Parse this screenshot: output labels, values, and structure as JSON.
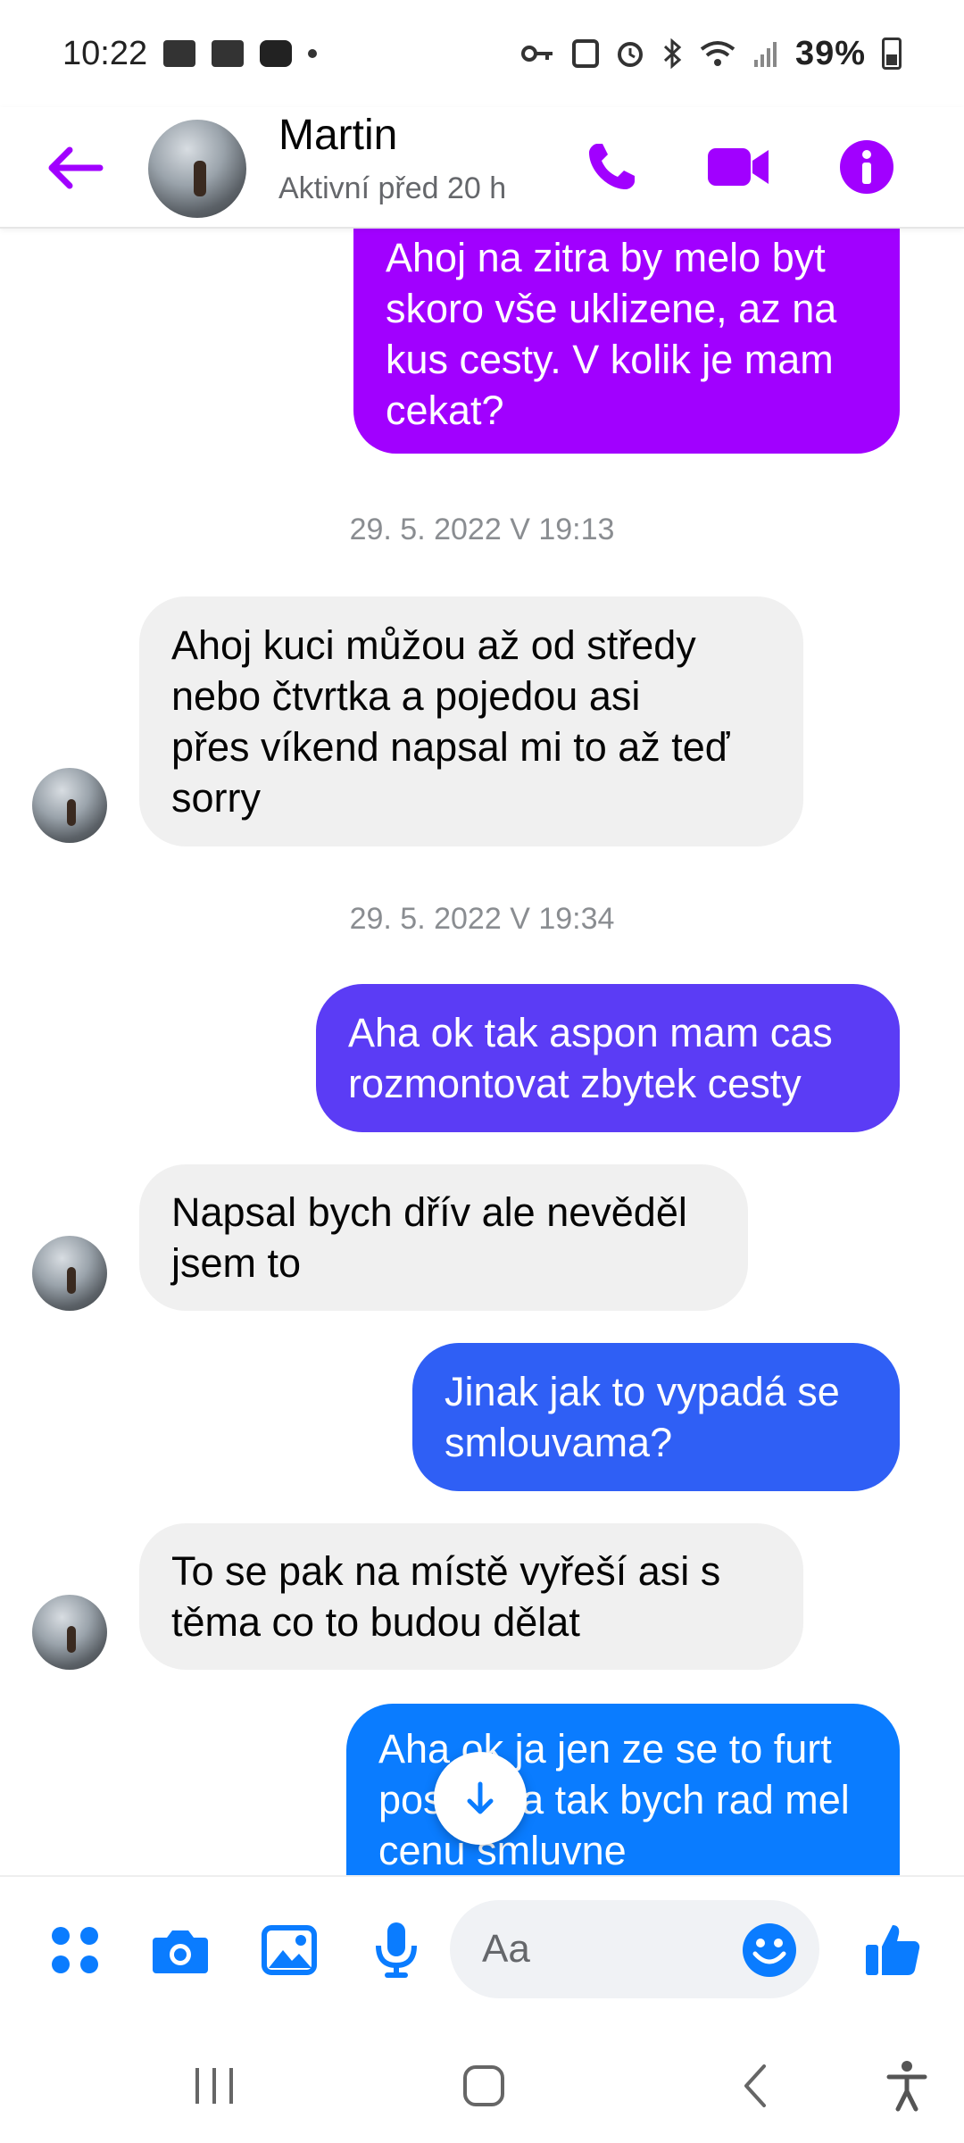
{
  "status_bar": {
    "time": "10:22",
    "battery": "39%"
  },
  "header": {
    "contact_name": "Martin",
    "contact_status": "Aktivní před 20 h"
  },
  "messages": [
    {
      "direction": "out",
      "text": "Ahoj na zitra by melo byt\nskoro vše uklizene, az na\nkus cesty. V kolik je mam\ncekat?",
      "color": "#a100ff"
    },
    {
      "type": "timestamp",
      "text": "29. 5. 2022 V 19:13"
    },
    {
      "direction": "in",
      "text": "Ahoj kuci můžou až od středy\nnebo čtvrtka a pojedou asi\npřes víkend napsal mi to až teď\nsorry"
    },
    {
      "type": "timestamp",
      "text": "29. 5. 2022 V 19:34"
    },
    {
      "direction": "out",
      "text": "Aha ok tak aspon mam cas\nrozmontovat zbytek cesty",
      "color": "#5b3cf5"
    },
    {
      "direction": "in",
      "text": "Napsal bych dřív ale nevěděl\njsem to"
    },
    {
      "direction": "out",
      "text": "Jinak jak to vypadá se\nsmlouvama?",
      "color": "#2f5ff5"
    },
    {
      "direction": "in",
      "text": "To se pak na místě vyřeší asi s\ntěma co to budou dělat"
    },
    {
      "direction": "out",
      "text": "Aha ok ja jen ze se to furt\nposune a tak bych rad mel\ncenu smluvne",
      "color": "#0a7cff"
    }
  ],
  "composer": {
    "placeholder": "Aa"
  },
  "colors": {
    "accent": "#a100ff",
    "composer_blue": "#0a7cff"
  },
  "icons": {
    "back": "arrow-left-icon",
    "call": "phone-icon",
    "video": "video-camera-icon",
    "info": "info-icon",
    "apps": "four-dots-icon",
    "camera": "camera-icon",
    "gallery": "image-icon",
    "mic": "microphone-icon",
    "emoji": "smiley-icon",
    "like": "thumbs-up-icon",
    "scroll": "arrow-down-icon"
  }
}
